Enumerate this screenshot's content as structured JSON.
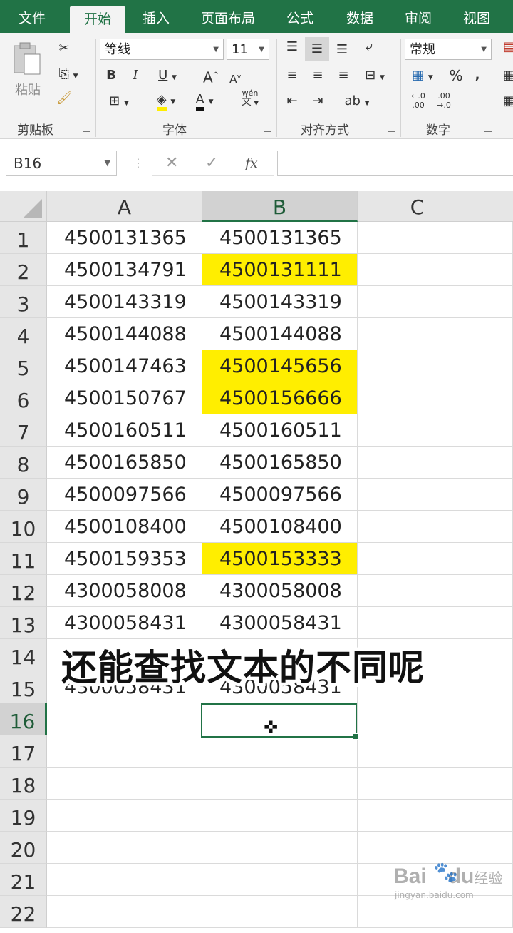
{
  "tabs": [
    {
      "label": "文件"
    },
    {
      "label": "开始"
    },
    {
      "label": "插入"
    },
    {
      "label": "页面布局"
    },
    {
      "label": "公式"
    },
    {
      "label": "数据"
    },
    {
      "label": "审阅"
    },
    {
      "label": "视图"
    }
  ],
  "ribbon": {
    "clipboard": {
      "paste_label": "粘贴",
      "group_label": "剪贴板"
    },
    "font": {
      "font_name": "等线",
      "font_size": "11",
      "group_label": "字体",
      "wen_label": "wén",
      "wen_char": "文"
    },
    "alignment": {
      "group_label": "对齐方式"
    },
    "number": {
      "format": "常规",
      "group_label": "数字",
      "inc_decimal": "←.0\n.00",
      "dec_decimal": ".00\n→.0"
    }
  },
  "formula_bar": {
    "name_box": "B16",
    "cancel": "✕",
    "enter": "✓",
    "fx": "fx",
    "content": ""
  },
  "columns": [
    "A",
    "B",
    "C"
  ],
  "rows": [
    {
      "num": "1",
      "a": "4500131365",
      "b": "4500131365",
      "hl": false
    },
    {
      "num": "2",
      "a": "4500134791",
      "b": "4500131111",
      "hl": true
    },
    {
      "num": "3",
      "a": "4500143319",
      "b": "4500143319",
      "hl": false
    },
    {
      "num": "4",
      "a": "4500144088",
      "b": "4500144088",
      "hl": false
    },
    {
      "num": "5",
      "a": "4500147463",
      "b": "4500145656",
      "hl": true
    },
    {
      "num": "6",
      "a": "4500150767",
      "b": "4500156666",
      "hl": true
    },
    {
      "num": "7",
      "a": "4500160511",
      "b": "4500160511",
      "hl": false
    },
    {
      "num": "8",
      "a": "4500165850",
      "b": "4500165850",
      "hl": false
    },
    {
      "num": "9",
      "a": "4500097566",
      "b": "4500097566",
      "hl": false
    },
    {
      "num": "10",
      "a": "4500108400",
      "b": "4500108400",
      "hl": false
    },
    {
      "num": "11",
      "a": "4500159353",
      "b": "4500153333",
      "hl": true
    },
    {
      "num": "12",
      "a": "4300058008",
      "b": "4300058008",
      "hl": false
    },
    {
      "num": "13",
      "a": "4300058431",
      "b": "4300058431",
      "hl": false
    },
    {
      "num": "14",
      "a": "",
      "b": "",
      "hl": false
    },
    {
      "num": "15",
      "a": "4300058431",
      "b": "4300058431",
      "hl": false
    },
    {
      "num": "16",
      "a": "",
      "b": "",
      "hl": false
    },
    {
      "num": "17",
      "a": "",
      "b": "",
      "hl": false
    },
    {
      "num": "18",
      "a": "",
      "b": "",
      "hl": false
    },
    {
      "num": "19",
      "a": "",
      "b": "",
      "hl": false
    },
    {
      "num": "20",
      "a": "",
      "b": "",
      "hl": false
    },
    {
      "num": "21",
      "a": "",
      "b": "",
      "hl": false
    },
    {
      "num": "22",
      "a": "",
      "b": "",
      "hl": false
    }
  ],
  "selected_cell": "B16",
  "highlight_color": "#ffee00",
  "accent_color": "#217346",
  "caption": "还能查找文本的不同呢",
  "watermark": {
    "logo": "Bai",
    "logo2": "du",
    "suffix": "经验",
    "url": "jingyan.baidu.com"
  }
}
